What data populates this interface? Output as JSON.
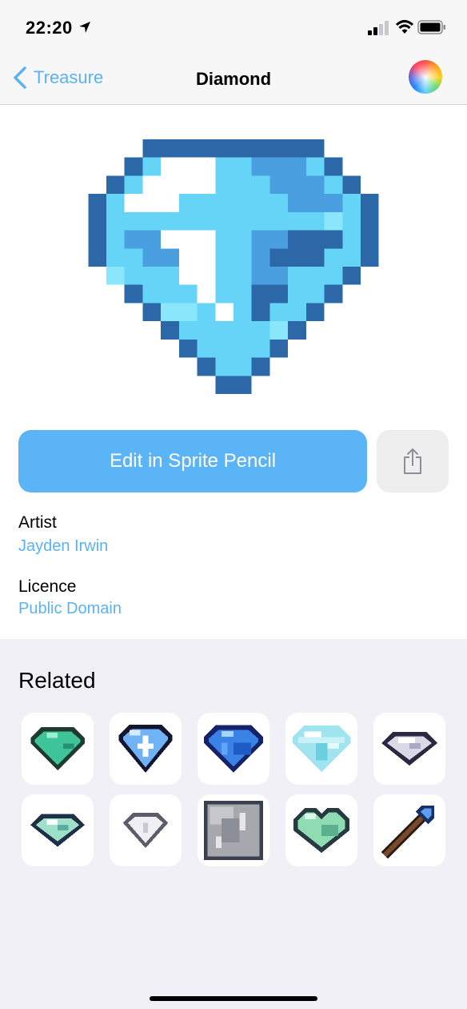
{
  "status_bar": {
    "time": "22:20",
    "location_icon": "location-arrow-icon",
    "signal_icon": "cellular-signal-icon",
    "wifi_icon": "wifi-icon",
    "battery_icon": "battery-icon"
  },
  "nav": {
    "back_label": "Treasure",
    "title": "Diamond",
    "color_button_icon": "color-wheel-icon"
  },
  "actions": {
    "edit_label": "Edit in Sprite Pencil",
    "share_icon": "share-icon"
  },
  "details": {
    "artist_label": "Artist",
    "artist_value": "Jayden Irwin",
    "licence_label": "Licence",
    "licence_value": "Public Domain"
  },
  "related": {
    "title": "Related",
    "items": [
      {
        "icon": "green-gem-icon"
      },
      {
        "icon": "sparkle-gem-icon"
      },
      {
        "icon": "blue-gem-icon"
      },
      {
        "icon": "pale-diamond-icon"
      },
      {
        "icon": "silver-gem-icon"
      },
      {
        "icon": "mint-gem-icon"
      },
      {
        "icon": "small-silver-gem-icon"
      },
      {
        "icon": "metal-block-icon"
      },
      {
        "icon": "gem-heart-icon"
      },
      {
        "icon": "gem-wand-icon"
      }
    ]
  },
  "colors": {
    "accent": "#5ab2f4",
    "button": "#5ab4f6",
    "background": "#f0f0f6"
  }
}
